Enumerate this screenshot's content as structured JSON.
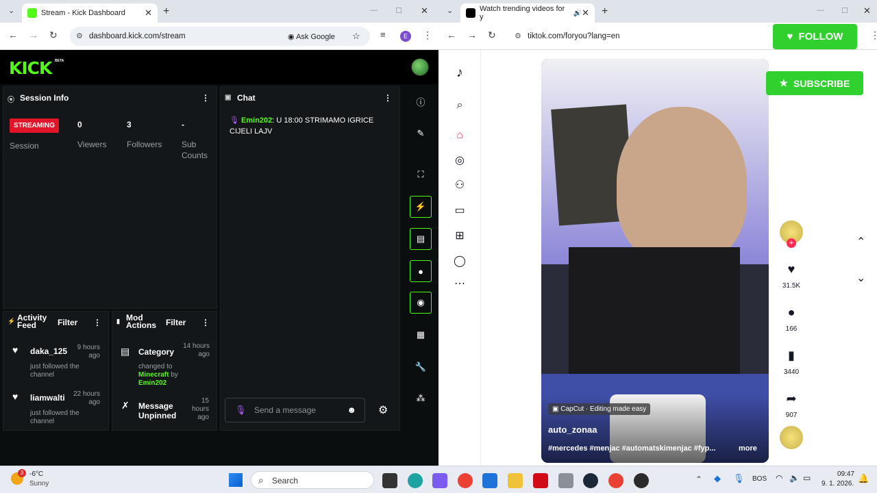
{
  "left_browser": {
    "tab_title": "Stream - Kick Dashboard",
    "url": "dashboard.kick.com/stream",
    "ask_google": "Ask Google",
    "profile_letter": "E"
  },
  "kick": {
    "logo": "KICK",
    "beta": "BETA",
    "session": {
      "title": "Session Info",
      "badge": "STREAMING",
      "session_label": "Session",
      "viewers_value": "0",
      "viewers_label": "Viewers",
      "followers_value": "3",
      "followers_label": "Followers",
      "subs_value": "-",
      "subs_label": "Sub Counts"
    },
    "chat": {
      "title": "Chat",
      "user": "Emin202",
      "message": ": U 18:00 STRIMAMO IGRICE CIJELI LAJV",
      "input_placeholder": "Send a message"
    },
    "activity": {
      "title": "Activity Feed",
      "filter": "Filter",
      "items": [
        {
          "user": "daka_125",
          "text": "just followed the channel",
          "time": "9 hours ago"
        },
        {
          "user": "liamwalti",
          "text": "just followed the channel",
          "time": "22 hours ago"
        }
      ]
    },
    "mod": {
      "title": "Mod Actions",
      "filter": "Filter",
      "item1_title": "Category",
      "item1_pre": "changed to",
      "item1_game": "Minecraft",
      "item1_by": "by",
      "item1_user": "Emin202",
      "item1_time": "14 hours ago",
      "item2_title": "Message Unpinned",
      "item2_time": "15 hours ago"
    }
  },
  "right_browser": {
    "tab_title": "Watch trending videos for y",
    "url": "tiktok.com/foryou?lang=en"
  },
  "tiktok": {
    "capcut": "CapCut · Editing made easy",
    "author": "auto_zonaa",
    "caption": "#mercedes #menjac #automatskimenjac #fyp...",
    "more": "more",
    "likes": "31.5K",
    "comments": "166",
    "saves": "3440",
    "shares": "907",
    "follow_btn": "FOLLOW",
    "subscribe_btn": "SUBSCRIBE"
  },
  "taskbar": {
    "weather_temp": "-6°C",
    "weather_desc": "Sunny",
    "weather_badge": "3",
    "search": "Search",
    "lang": "BOS",
    "time": "09:47",
    "date": "9. 1. 2026."
  },
  "colors": {
    "kick_green": "#53fc18",
    "streaming_red": "#e0152a",
    "tiktok_pink": "#fe2c55"
  }
}
